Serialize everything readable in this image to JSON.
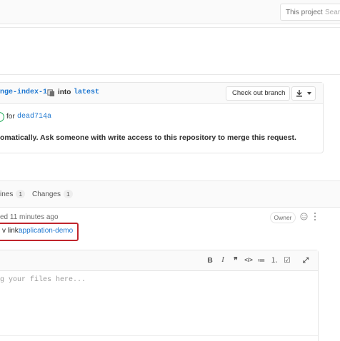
{
  "colors": {
    "link": "#1f78d1",
    "success": "#1aaa55",
    "highlight": "#c0252c",
    "border": "#e5e5e5"
  },
  "header": {
    "search_scope": "This project",
    "search_placeholder": "Search"
  },
  "merge_request": {
    "source_branch": "nge-index-1",
    "into_label": "into",
    "target_branch": "latest",
    "checkout_button": "Check out branch",
    "icons": {
      "copy": "copy-icon",
      "download": "download-icon",
      "caret": "caret-down-icon"
    }
  },
  "pipeline": {
    "status_icon": "pipeline-status-icon",
    "for_label": "for",
    "commit": "dead714a",
    "suffix": "."
  },
  "merge_message": "omatically. Ask someone with write access to this repository to merge this request.",
  "tabs": [
    {
      "label": "ines",
      "count": "1"
    },
    {
      "label": "Changes",
      "count": "1"
    }
  ],
  "note": {
    "header": "ed 11 minutes ago",
    "role": "Owner",
    "body_label": "v link:",
    "link_text": "application-demo",
    "icons": {
      "emoji": "smiley-icon",
      "more": "more-actions-icon"
    }
  },
  "editor": {
    "toolbar": [
      {
        "name": "bold-icon",
        "glyph": "B"
      },
      {
        "name": "italic-icon",
        "glyph": "I"
      },
      {
        "name": "quote-icon",
        "glyph": "❞"
      },
      {
        "name": "code-icon",
        "glyph": "</>"
      },
      {
        "name": "bullet-list-icon",
        "glyph": "≔"
      },
      {
        "name": "numbered-list-icon",
        "glyph": "⒈"
      },
      {
        "name": "task-list-icon",
        "glyph": "☑"
      },
      {
        "name": "fullscreen-icon",
        "glyph": "⤢"
      }
    ],
    "placeholder": "g your files here..."
  }
}
